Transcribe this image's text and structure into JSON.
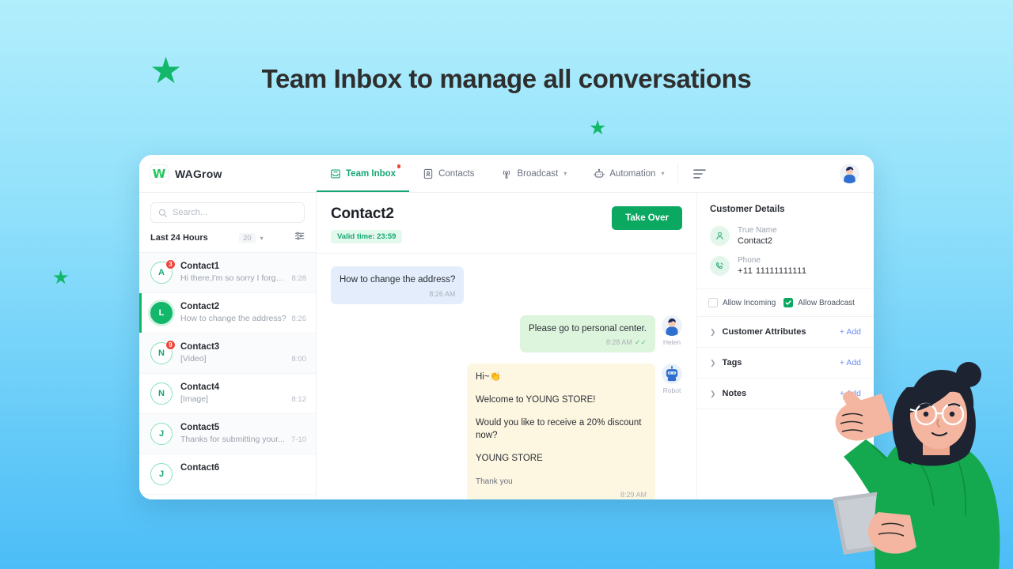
{
  "headline": "Team Inbox to manage all conversations",
  "app": {
    "brand": {
      "mark": "W",
      "name": "WAGrow"
    },
    "nav": [
      {
        "label": "Team Inbox",
        "icon": "inbox-icon",
        "active": true,
        "dot": true,
        "caret": false
      },
      {
        "label": "Contacts",
        "icon": "contact-card-icon",
        "active": false,
        "dot": false,
        "caret": false
      },
      {
        "label": "Broadcast",
        "icon": "broadcast-icon",
        "active": false,
        "dot": false,
        "caret": true
      },
      {
        "label": "Automation",
        "icon": "robot-icon",
        "active": false,
        "dot": false,
        "caret": true
      }
    ],
    "menu_icon": "hamburger-icon",
    "user_avatar": "user-avatar"
  },
  "list": {
    "search_placeholder": "Search...",
    "filter_label": "Last 24 Hours",
    "count": "20",
    "filter_icon": "sliders-icon",
    "conversations": [
      {
        "name": "Contact1",
        "initial": "A",
        "preview": "Hi there,I'm so sorry I forgot...",
        "time": "8:28",
        "badge": "3",
        "active": false
      },
      {
        "name": "Contact2",
        "initial": "L",
        "preview": "How to change the address?",
        "time": "8:26",
        "badge": "",
        "active": true
      },
      {
        "name": "Contact3",
        "initial": "N",
        "preview": "[Video]",
        "time": "8:00",
        "badge": "9",
        "active": false
      },
      {
        "name": "Contact4",
        "initial": "N",
        "preview": "[Image]",
        "time": "8:12",
        "badge": "",
        "active": false
      },
      {
        "name": "Contact5",
        "initial": "J",
        "preview": "Thanks for submitting your...",
        "time": "7-10",
        "badge": "",
        "active": false
      },
      {
        "name": "Contact6",
        "initial": "J",
        "preview": "",
        "time": "",
        "badge": "",
        "active": false
      }
    ]
  },
  "chat": {
    "title": "Contact2",
    "valid_pill": "Valid time: 23:59",
    "take_over": "Take Over",
    "messages": {
      "incoming": {
        "text": "How to change the address?",
        "time": "8:26 AM"
      },
      "outgoing": {
        "text": "Please go to personal center.",
        "time": "8:28 AM",
        "sender": "Helen",
        "tick": "✓✓"
      },
      "bot": {
        "line1": "Hi~👏",
        "line2": "Welcome to YOUNG STORE!",
        "line3": "Would you like to receive a 20% discount now?",
        "line4": "YOUNG STORE",
        "thanks": "Thank you",
        "time": "8:29 AM",
        "sender": "Robot"
      }
    }
  },
  "details": {
    "title": "Customer Details",
    "fields": [
      {
        "label": "True Name",
        "value": "Contact2",
        "icon": "person-icon"
      },
      {
        "label": "Phone",
        "value": "+11 11111111111",
        "icon": "phone-icon"
      }
    ],
    "checkboxes": [
      {
        "label": "Allow Incoming",
        "checked": false
      },
      {
        "label": "Allow Broadcast",
        "checked": true
      }
    ],
    "accordions": [
      {
        "label": "Customer Attributes",
        "add": "+ Add"
      },
      {
        "label": "Tags",
        "add": "+ Add"
      },
      {
        "label": "Notes",
        "add": "+ Add"
      }
    ]
  },
  "colors": {
    "brand_green": "#12b76a",
    "button_green": "#0aa860",
    "active_tab": "#17a673",
    "badge_red": "#f0453a",
    "add_link": "#6e8df7",
    "bubble_in": "#e3edfb",
    "bubble_out": "#ddf5dd",
    "bubble_bot": "#fdf6e0"
  }
}
